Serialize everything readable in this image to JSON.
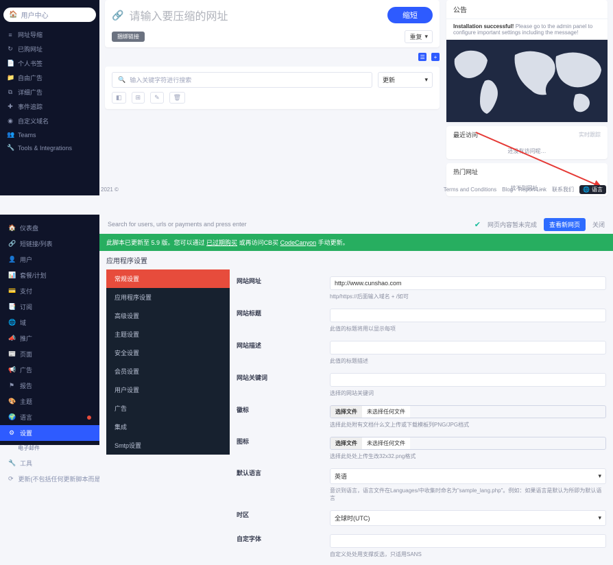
{
  "upper": {
    "sidebar": {
      "search_label": "用户中心",
      "items": [
        {
          "icon": "≡",
          "label": "网址导缩"
        },
        {
          "icon": "↻",
          "label": "已购网址"
        },
        {
          "icon": "📄",
          "label": "个人书签"
        },
        {
          "icon": "📁",
          "label": "自由广告"
        },
        {
          "icon": "⧉",
          "label": "详细广告"
        },
        {
          "icon": "✚",
          "label": "事件追踪"
        },
        {
          "icon": "◉",
          "label": "自定义域名"
        },
        {
          "icon": "👥",
          "label": "Teams"
        },
        {
          "icon": "🔧",
          "label": "Tools & Integrations"
        }
      ]
    },
    "shorten": {
      "placeholder": "请输入要压缩的网址",
      "button": "缩短",
      "foot_left": "捆绑链接",
      "foot_right": "重复",
      "badge1": "☰",
      "badge2": "+"
    },
    "filter": {
      "search_placeholder": "输入关键字符进行搜索",
      "sort": "更新",
      "icons": [
        "◧",
        "⊞",
        "✎",
        "🗑"
      ]
    },
    "announce": {
      "title": "公告",
      "body_strong": "Installation successful!",
      "body_rest": " Please go to the admin panel to configure important settings including the message!"
    },
    "recent": {
      "title": "最近访问",
      "right": "实时跟踪",
      "msg": "还没有访问呢…"
    },
    "hot": {
      "title": "热门网址",
      "msg": "找不到网址…"
    },
    "footer": {
      "copyright": "2021 ©",
      "links": [
        "Terms and Conditions",
        "Blog",
        "Report Link",
        "联系我们"
      ],
      "lang_btn": "语言"
    }
  },
  "lower": {
    "topbar": {
      "search_placeholder": "Search for users, urls or payments and press enter",
      "status": "网页内容暂未完成",
      "blue_btn": "查看新网页",
      "far": "关闭"
    },
    "green_bar": {
      "t1": "此脚本已更新至 5.9 版。您可以通过",
      "l1": "已过期购买",
      "t2": "或再访问CB买",
      "l2": "CodeCanyon",
      "t3": "手动更新。"
    },
    "sidebar": [
      {
        "icon": "🏠",
        "label": "仪表盘"
      },
      {
        "icon": "🔗",
        "label": "短链接/列表"
      },
      {
        "icon": "👤",
        "label": "用户"
      },
      {
        "icon": "📊",
        "label": "套餐/计划"
      },
      {
        "icon": "💳",
        "label": "支付"
      },
      {
        "icon": "📑",
        "label": "订阅"
      },
      {
        "icon": "🌐",
        "label": "域"
      },
      {
        "icon": "📣",
        "label": "推广"
      },
      {
        "icon": "📰",
        "label": "页面"
      },
      {
        "icon": "📢",
        "label": "广告"
      },
      {
        "icon": "⚑",
        "label": "报告"
      },
      {
        "icon": "🎨",
        "label": "主题"
      },
      {
        "icon": "🌍",
        "label": "语言",
        "dot": true
      },
      {
        "icon": "⚙",
        "label": "设置",
        "active": true
      },
      {
        "icon": "",
        "label": "电子邮件",
        "sub": true
      },
      {
        "icon": "🔧",
        "label": "工具"
      },
      {
        "icon": "⟳",
        "label": "更新(不包括任何更新脚本而是HTMASC下载更新)"
      }
    ],
    "section_title": "应用程序设置",
    "settings_nav": [
      "常规设置",
      "应用程序设置",
      "高级设置",
      "主题设置",
      "安全设置",
      "会员设置",
      "用户设置",
      "广告",
      "集成",
      "Smtp设置"
    ],
    "form": {
      "site_url": {
        "label": "网站网址",
        "value": "http://www.cunshao.com",
        "hint": "http/https://后面输入域名 + /如可"
      },
      "site_title": {
        "label": "网站标题",
        "value": "",
        "hint": "此值的标题将用以显示每项"
      },
      "site_desc": {
        "label": "网站描述",
        "value": "",
        "hint": "此值的标题描述"
      },
      "keywords": {
        "label": "网站关键词",
        "value": "",
        "hint": "选择的网站关键词"
      },
      "favicon": {
        "label": "徽标",
        "btn_a": "选择文件",
        "btn_b": "未选择任何文件",
        "hint": "选择此处附有文档什么文上传或下载模板列PNG/JPG档式"
      },
      "icon": {
        "label": "图标",
        "btn_a": "选择文件",
        "btn_b": "未选择任何文件",
        "hint": "选择此处处上传生改32x32.png格式"
      },
      "lang": {
        "label": "默认语言",
        "sel": "英语",
        "hint": "意识到语言，语言文件在Languages/中收集时命名为\"sample_lang.php\"。例如：如果语言是默认为所即为默认语言"
      },
      "tz": {
        "label": "时区",
        "sel": "全球时(UTC)"
      },
      "font": {
        "label": "自定字体",
        "value": "",
        "hint": "自定义处处用支撑反选，只适用SANS"
      }
    }
  }
}
